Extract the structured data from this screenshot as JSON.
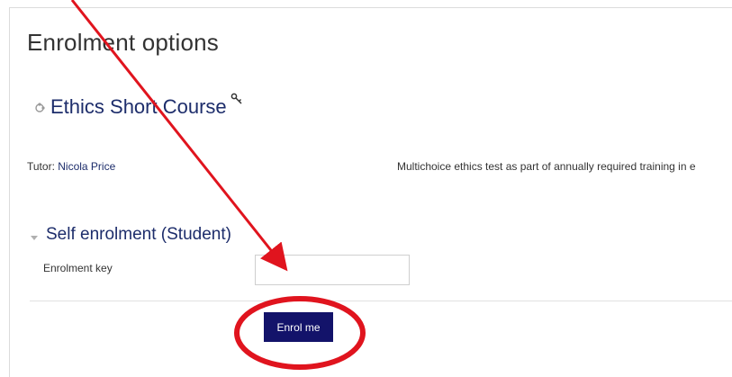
{
  "page": {
    "title": "Enrolment options"
  },
  "course": {
    "name": "Ethics Short Course",
    "icon": "course-puzzle-icon",
    "key_icon": "key-icon",
    "tutor_label": "Tutor:",
    "tutor_name": "Nicola Price",
    "summary": "Multichoice ethics test as part of annually required training in e"
  },
  "enrolment": {
    "section_title": "Self enrolment (Student)",
    "key_label": "Enrolment key",
    "key_value": "",
    "button_label": "Enrol me"
  },
  "annotation": {
    "color": "#e0141e"
  },
  "colors": {
    "accent": "#1d2d6b",
    "button": "#13136a"
  }
}
